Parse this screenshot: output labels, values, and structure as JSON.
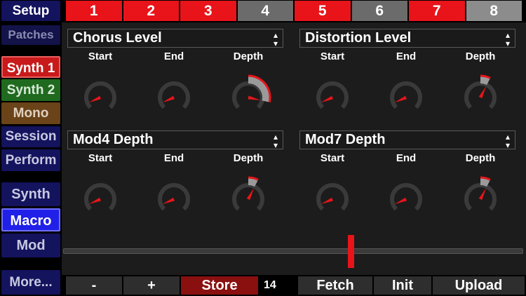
{
  "sidebar": {
    "setup": "Setup",
    "patches": "Patches",
    "synth1": "Synth 1",
    "synth2": "Synth 2",
    "mono": "Mono",
    "session": "Session",
    "perform": "Perform",
    "synth": "Synth",
    "macro": "Macro",
    "mod": "Mod",
    "more": "More..."
  },
  "tabs": [
    {
      "label": "1",
      "active": true
    },
    {
      "label": "2",
      "active": true
    },
    {
      "label": "3",
      "active": true
    },
    {
      "label": "4",
      "active": false
    },
    {
      "label": "5",
      "active": true
    },
    {
      "label": "6",
      "active": false
    },
    {
      "label": "7",
      "active": true
    },
    {
      "label": "8",
      "active": false
    }
  ],
  "macros": [
    {
      "title": "Chorus Level",
      "start": 0.08,
      "end": 0.08,
      "depth": 0.88
    },
    {
      "title": "Distortion Level",
      "start": 0.08,
      "end": 0.08,
      "depth": 0.6
    },
    {
      "title": "Mod4 Depth",
      "start": 0.08,
      "end": 0.08,
      "depth": 0.6
    },
    {
      "title": "Mod7 Depth",
      "start": 0.08,
      "end": 0.08,
      "depth": 0.6
    }
  ],
  "knob_labels": {
    "start": "Start",
    "end": "End",
    "depth": "Depth"
  },
  "slider": {
    "value": 0.625
  },
  "bottom": {
    "minus": "-",
    "plus": "+",
    "store": "Store",
    "number": "14",
    "fetch": "Fetch",
    "init": "Init",
    "upload": "Upload"
  },
  "colors": {
    "accent_red": "#e8141a",
    "tab_inactive": "#6b6b6b",
    "synth1": "#c81a1a",
    "synth2": "#1f6a1f",
    "mono": "#6a4318",
    "nav_blue": "#13135e",
    "nav_bright": "#2020e8"
  }
}
